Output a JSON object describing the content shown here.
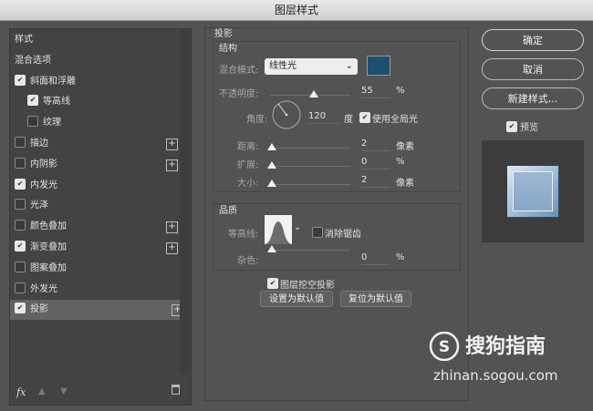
{
  "window_title": "图层样式",
  "sidebar": {
    "items": [
      {
        "label": "样式",
        "checkbox": false,
        "checked": false,
        "plus": false
      },
      {
        "label": "混合选项",
        "checkbox": false,
        "checked": false,
        "plus": false
      },
      {
        "label": "斜面和浮雕",
        "checkbox": true,
        "checked": true,
        "plus": false
      },
      {
        "label": "等高线",
        "checkbox": true,
        "checked": true,
        "plus": false
      },
      {
        "label": "纹理",
        "checkbox": true,
        "checked": false,
        "plus": false
      },
      {
        "label": "描边",
        "checkbox": true,
        "checked": false,
        "plus": true
      },
      {
        "label": "内阴影",
        "checkbox": true,
        "checked": false,
        "plus": true
      },
      {
        "label": "内发光",
        "checkbox": true,
        "checked": true,
        "plus": false
      },
      {
        "label": "光泽",
        "checkbox": true,
        "checked": false,
        "plus": false
      },
      {
        "label": "颜色叠加",
        "checkbox": true,
        "checked": false,
        "plus": true
      },
      {
        "label": "渐变叠加",
        "checkbox": true,
        "checked": true,
        "plus": true
      },
      {
        "label": "图案叠加",
        "checkbox": true,
        "checked": false,
        "plus": false
      },
      {
        "label": "外发光",
        "checkbox": true,
        "checked": false,
        "plus": false
      },
      {
        "label": "投影",
        "checkbox": true,
        "checked": true,
        "plus": true
      }
    ],
    "footer_fx": "fx"
  },
  "drop_shadow": {
    "section_title": "投影",
    "structure_title": "结构",
    "blend_mode_label": "混合模式:",
    "blend_mode_value": "线性光",
    "blend_color": "#1e4f6e",
    "opacity_label": "不透明度:",
    "opacity_value": "55",
    "opacity_unit": "%",
    "opacity_level": 0.55,
    "angle_label": "角度:",
    "angle_value": "120",
    "angle_unit": "度",
    "global_light_label": "使用全局光",
    "global_light_checked": true,
    "distance_label": "距离:",
    "distance_value": "2",
    "distance_unit": "像素",
    "spread_label": "扩展:",
    "spread_value": "0",
    "spread_unit": "%",
    "size_label": "大小:",
    "size_value": "2",
    "size_unit": "像素",
    "quality_title": "品质",
    "contour_label": "等高线:",
    "antialias_label": "消除锯齿",
    "antialias_checked": false,
    "noise_label": "杂色:",
    "noise_value": "0",
    "noise_unit": "%",
    "knockout_label": "图层挖空投影",
    "knockout_checked": true,
    "set_default_label": "设置为默认值",
    "reset_default_label": "复位为默认值"
  },
  "right": {
    "ok_label": "确定",
    "cancel_label": "取消",
    "new_style_label": "新建样式...",
    "preview_label": "预览",
    "preview_checked": true
  },
  "watermark": {
    "brand": "搜狗指南",
    "url": "zhinan.sogou.com"
  }
}
